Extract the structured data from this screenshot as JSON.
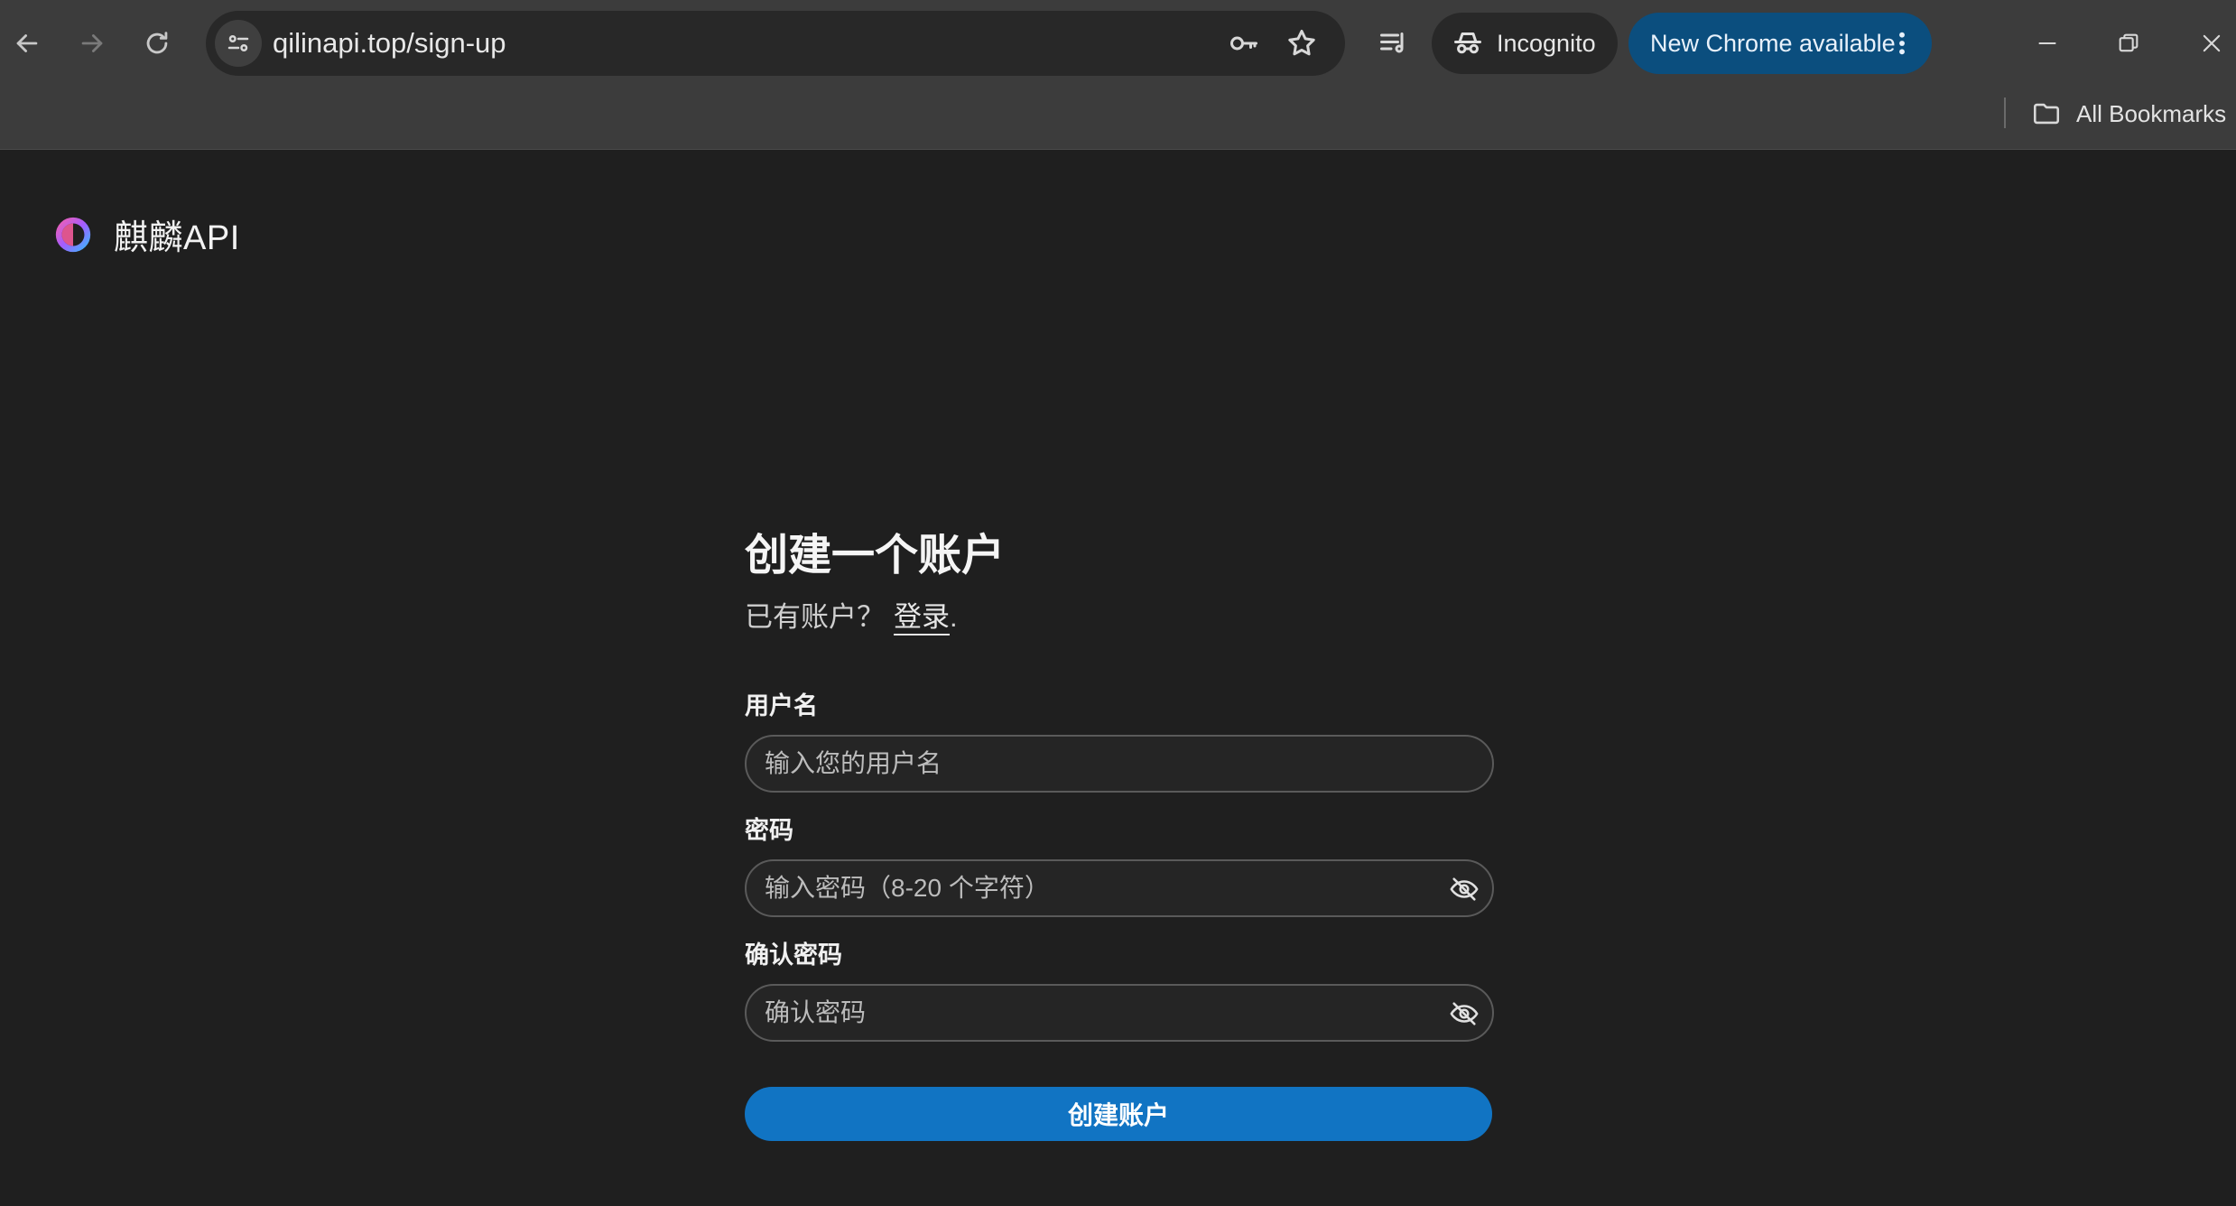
{
  "browser": {
    "url": "qilinapi.top/sign-up",
    "incognito_label": "Incognito",
    "update_label": "New Chrome available",
    "bookmarks_label": "All Bookmarks"
  },
  "brand": {
    "name": "麒麟API"
  },
  "form": {
    "title": "创建一个账户",
    "subtitle_prefix": "已有账户？",
    "login_link": "登录",
    "subtitle_suffix": ".",
    "username_label": "用户名",
    "username_placeholder": "输入您的用户名",
    "password_label": "密码",
    "password_placeholder": "输入密码（8-20 个字符）",
    "confirm_label": "确认密码",
    "confirm_placeholder": "确认密码",
    "submit_label": "创建账户"
  },
  "colors": {
    "page_bg": "#1f1f1f",
    "chrome_bg": "#3c3c3c",
    "primary_button": "#1174c3",
    "update_chip": "#0b4e7e"
  },
  "icons": {
    "back": "arrow-left-icon",
    "forward": "arrow-right-icon",
    "reload": "reload-icon",
    "site_info": "tune-icon",
    "password_key": "key-icon",
    "bookmark_star": "star-icon",
    "media": "playlist-icon",
    "incognito": "incognito-icon",
    "menu": "kebab-menu-icon",
    "minimize": "minimize-icon",
    "restore": "restore-icon",
    "close": "close-icon",
    "folder": "folder-icon",
    "logo": "qilin-logo-icon",
    "toggle_visibility": "eye-off-icon"
  }
}
